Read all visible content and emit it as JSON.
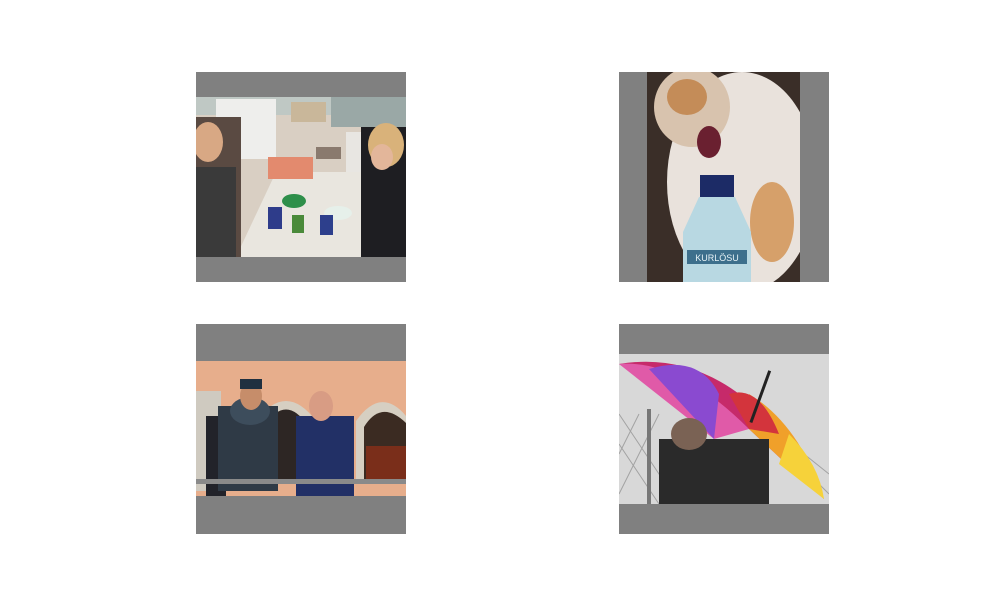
{
  "grid": {
    "background_color": "#ffffff",
    "letterbox_color": "#808080",
    "tiles": [
      {
        "subject": "friends-eating-at-kitchen-table"
      },
      {
        "subject": "cat-sniffing-water-bottle",
        "bottle_label": "KURLÖSU"
      },
      {
        "subject": "man-in-armor-on-balcony"
      },
      {
        "subject": "person-with-rainbow-umbrella"
      }
    ]
  }
}
